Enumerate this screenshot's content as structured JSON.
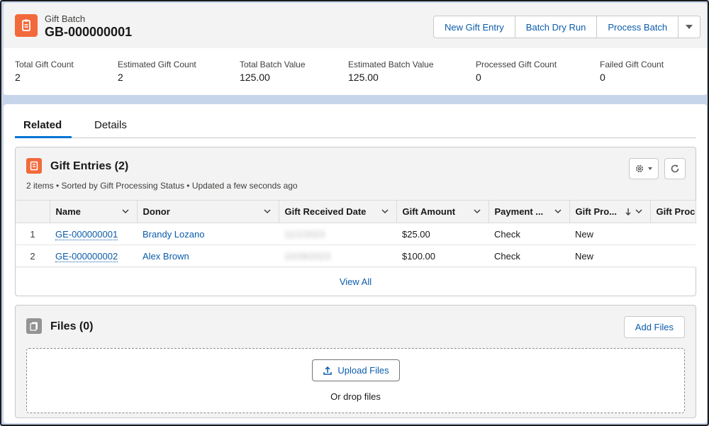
{
  "header": {
    "object_type": "Gift Batch",
    "record_name": "GB-000000001",
    "buttons": [
      "New Gift Entry",
      "Batch Dry Run",
      "Process Batch"
    ],
    "fields": [
      {
        "label": "Total Gift Count",
        "value": "2"
      },
      {
        "label": "Estimated Gift Count",
        "value": "2"
      },
      {
        "label": "Total Batch Value",
        "value": "125.00"
      },
      {
        "label": "Estimated Batch Value",
        "value": "125.00"
      },
      {
        "label": "Processed Gift Count",
        "value": "0"
      },
      {
        "label": "Failed Gift Count",
        "value": "0"
      }
    ]
  },
  "tabs": [
    "Related",
    "Details"
  ],
  "gift_entries": {
    "title": "Gift Entries (2)",
    "subtitle": "2 items • Sorted by Gift Processing Status • Updated a few seconds ago",
    "columns": [
      "Name",
      "Donor",
      "Gift Received Date",
      "Gift Amount",
      "Payment ...",
      "Gift Pro...",
      "Gift Proce"
    ],
    "rows": [
      {
        "num": "1",
        "name": "GE-000000001",
        "donor": "Brandy Lozano",
        "date": "11/1/2023",
        "amount": "$25.00",
        "payment": "Check",
        "status": "New"
      },
      {
        "num": "2",
        "name": "GE-000000002",
        "donor": "Alex Brown",
        "date": "10/29/2023",
        "amount": "$100.00",
        "payment": "Check",
        "status": "New"
      }
    ],
    "view_all": "View All"
  },
  "files": {
    "title": "Files (0)",
    "add_button": "Add Files",
    "upload_button": "Upload Files",
    "drop_text": "Or drop files"
  },
  "colors": {
    "accent": "#0176d3",
    "link": "#0b5cab",
    "object_icon": "#f26a3c",
    "files_icon": "#939393",
    "background": "#c6d5ea"
  },
  "icons": [
    "gift-batch-icon",
    "chevron-down-icon",
    "gear-icon",
    "refresh-icon",
    "gift-entry-icon",
    "files-icon",
    "upload-icon",
    "sort-desc-icon"
  ]
}
